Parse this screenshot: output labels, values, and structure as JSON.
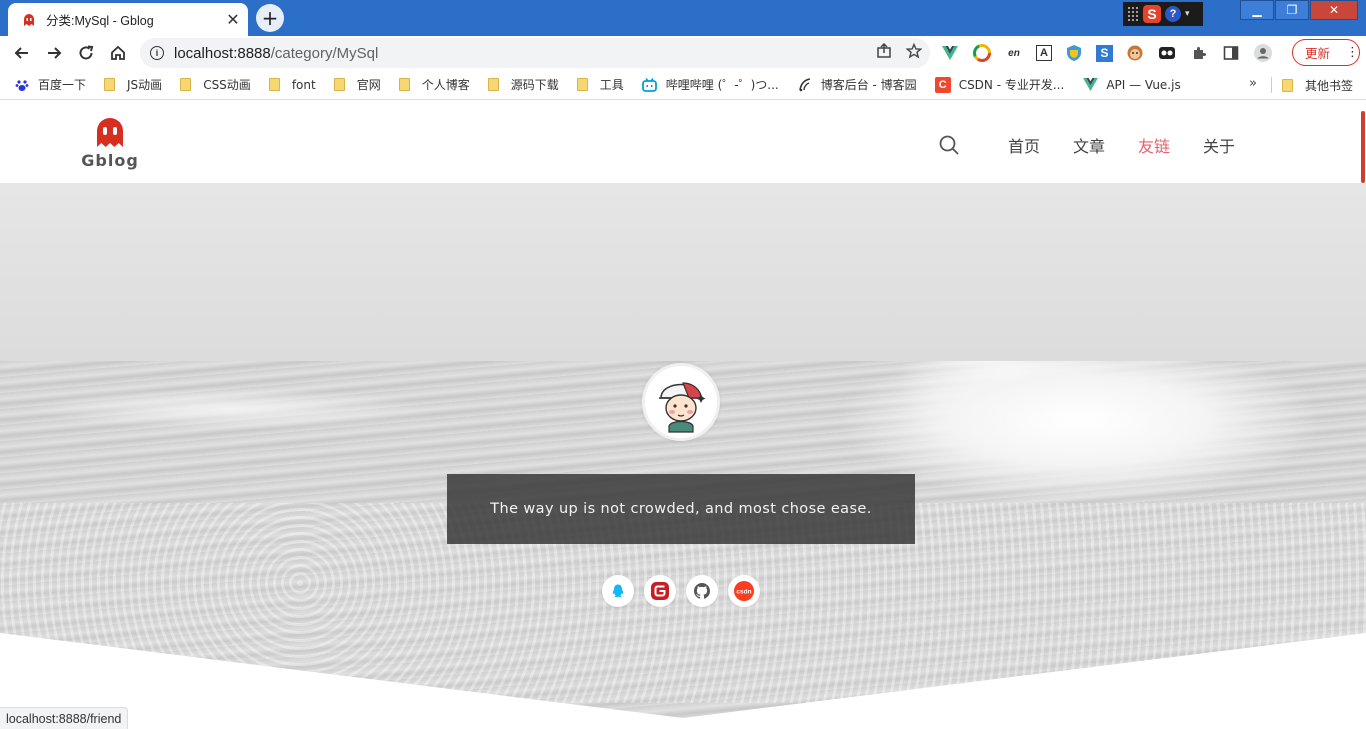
{
  "browser": {
    "tab_title": "分类:MySql - Gblog",
    "tab_close": "✕",
    "new_tab": "+",
    "url_host": "localhost:8888",
    "url_path": "/category/MySql",
    "update_label": "更新",
    "bookmarks": [
      {
        "label": "百度一下",
        "icon": "baidu-paw-icon"
      },
      {
        "label": "JS动画",
        "icon": "folder-icon"
      },
      {
        "label": "CSS动画",
        "icon": "folder-icon"
      },
      {
        "label": "font",
        "icon": "folder-icon"
      },
      {
        "label": "官网",
        "icon": "folder-icon"
      },
      {
        "label": "个人博客",
        "icon": "folder-icon"
      },
      {
        "label": "源码下载",
        "icon": "folder-icon"
      },
      {
        "label": "工具",
        "icon": "folder-icon"
      },
      {
        "label": "哔哩哔哩 (゜-゜)つ...",
        "icon": "bilibili-icon"
      },
      {
        "label": "博客后台 - 博客园",
        "icon": "cnblogs-icon"
      },
      {
        "label": "CSDN - 专业开发...",
        "icon": "csdn-icon"
      },
      {
        "label": "API — Vue.js",
        "icon": "vue-icon"
      }
    ],
    "bookmarks_more": "»",
    "other_bookmarks": "其他书签",
    "status_url": "localhost:8888/friend"
  },
  "site": {
    "logo_text": "Gblog",
    "nav": [
      {
        "label": "首页",
        "active": false
      },
      {
        "label": "文章",
        "active": false
      },
      {
        "label": "友链",
        "active": true
      },
      {
        "label": "关于",
        "active": false
      }
    ],
    "motto": "The way up is not crowded, and most chose ease.",
    "socials": [
      "qq-icon",
      "gitee-icon",
      "github-icon",
      "csdn-icon"
    ]
  },
  "colors": {
    "accent": "#e8606a",
    "titlebar": "#2b6fc9",
    "logo": "#d62f1f"
  }
}
